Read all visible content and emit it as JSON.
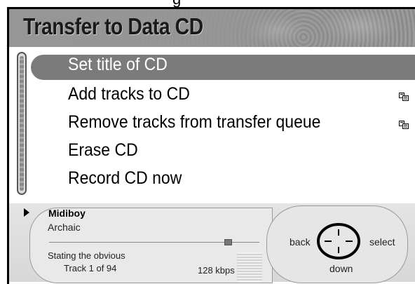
{
  "page_title": "Transfer to Data CD",
  "top_clip_text": "g",
  "menu": {
    "items": [
      {
        "label": "Set title of CD",
        "selected": true,
        "folder_icon": false
      },
      {
        "label": "Add tracks to CD",
        "selected": false,
        "folder_icon": true
      },
      {
        "label": "Remove tracks from transfer queue",
        "selected": false,
        "folder_icon": true
      },
      {
        "label": "Erase CD",
        "selected": false,
        "folder_icon": false
      },
      {
        "label": "Record CD now",
        "selected": false,
        "folder_icon": false
      }
    ]
  },
  "now_playing": {
    "artist": "Midiboy",
    "album": "Archaic",
    "song": "Stating the obvious",
    "track_position": "Track 1 of 94",
    "bitrate": "128 kbps",
    "progress_fraction": 0.85
  },
  "controls": {
    "back_label": "back",
    "select_label": "select",
    "down_label": "down"
  },
  "colors": {
    "selected_row": "#7b7b7b",
    "title_bar": "#959595"
  },
  "icons": {
    "play": "play-icon",
    "folder": "folder-stack-icon",
    "joystick": "joystick-icon"
  }
}
